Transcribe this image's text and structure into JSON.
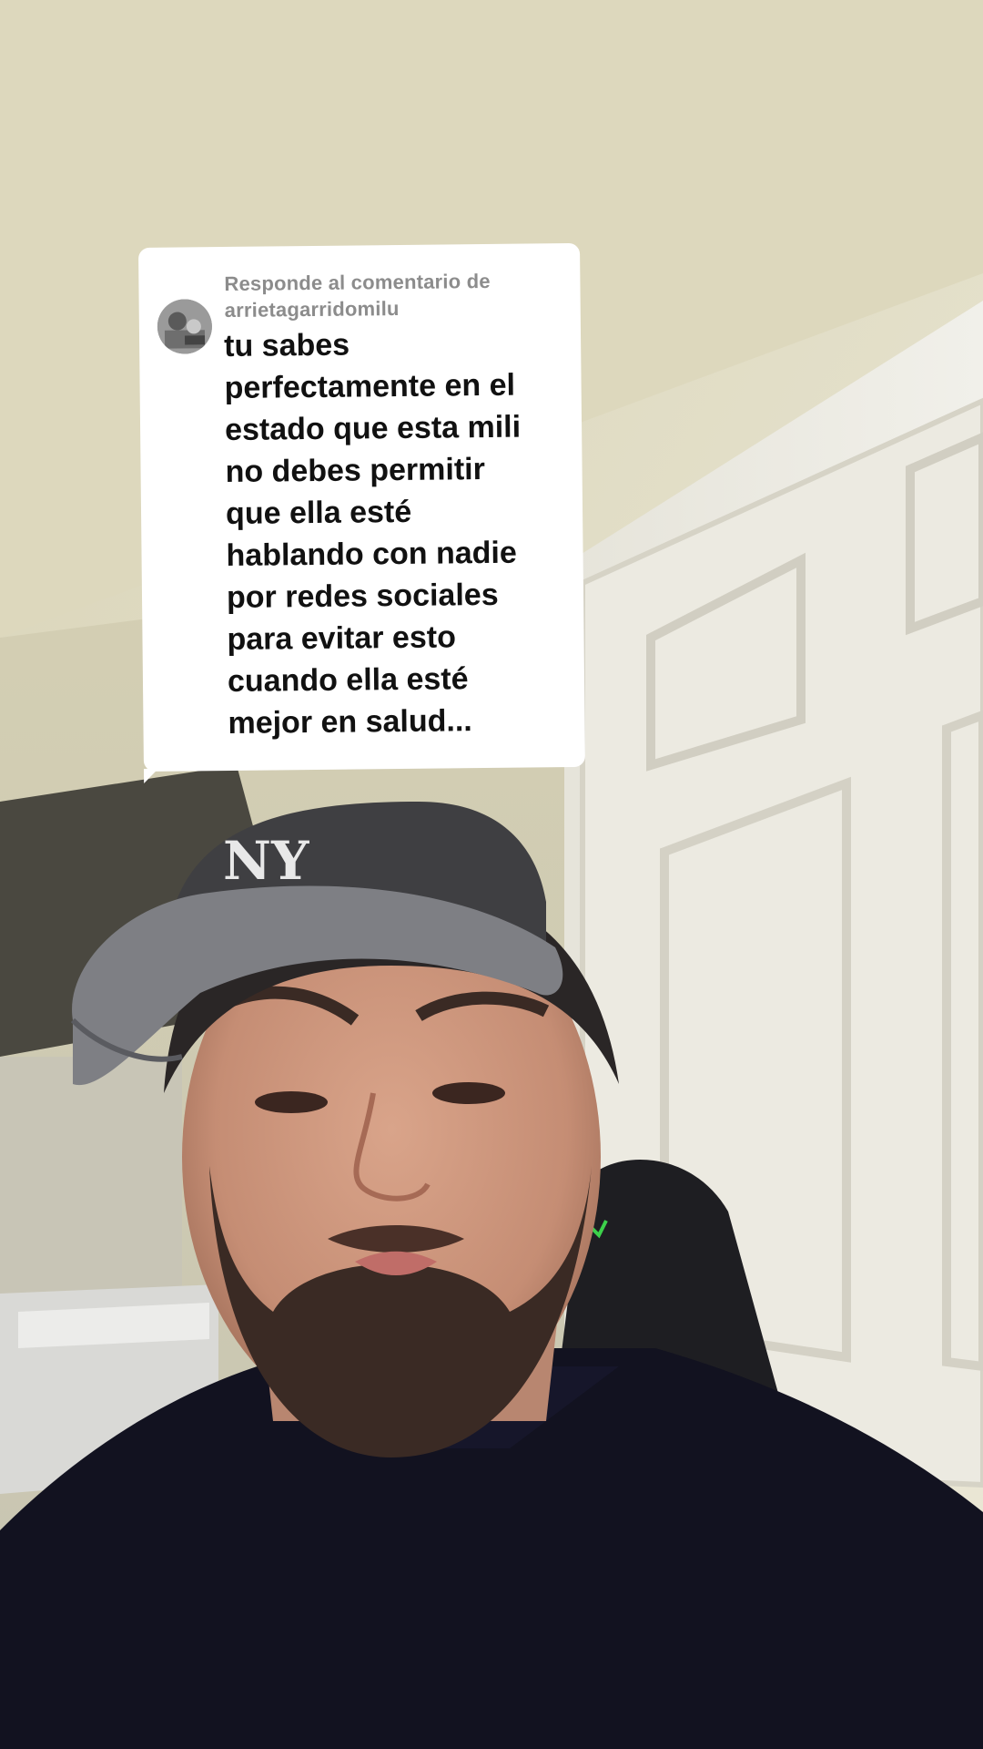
{
  "comment": {
    "header_prefix": "Responde al comentario de",
    "username": "arrietagarridomilu",
    "avatar_icon": "user-avatar-icon",
    "lines": [
      "tu sabes",
      "perfectamente en el",
      "estado que esta mili",
      "no debes permitir",
      "que ella esté",
      "hablando con nadie",
      "por redes sociales",
      "para evitar esto",
      "cuando ella esté",
      "mejor en salud..."
    ]
  },
  "colors": {
    "card_background": "#ffffff",
    "header_text": "#8c8c8c",
    "body_text": "#111111"
  }
}
